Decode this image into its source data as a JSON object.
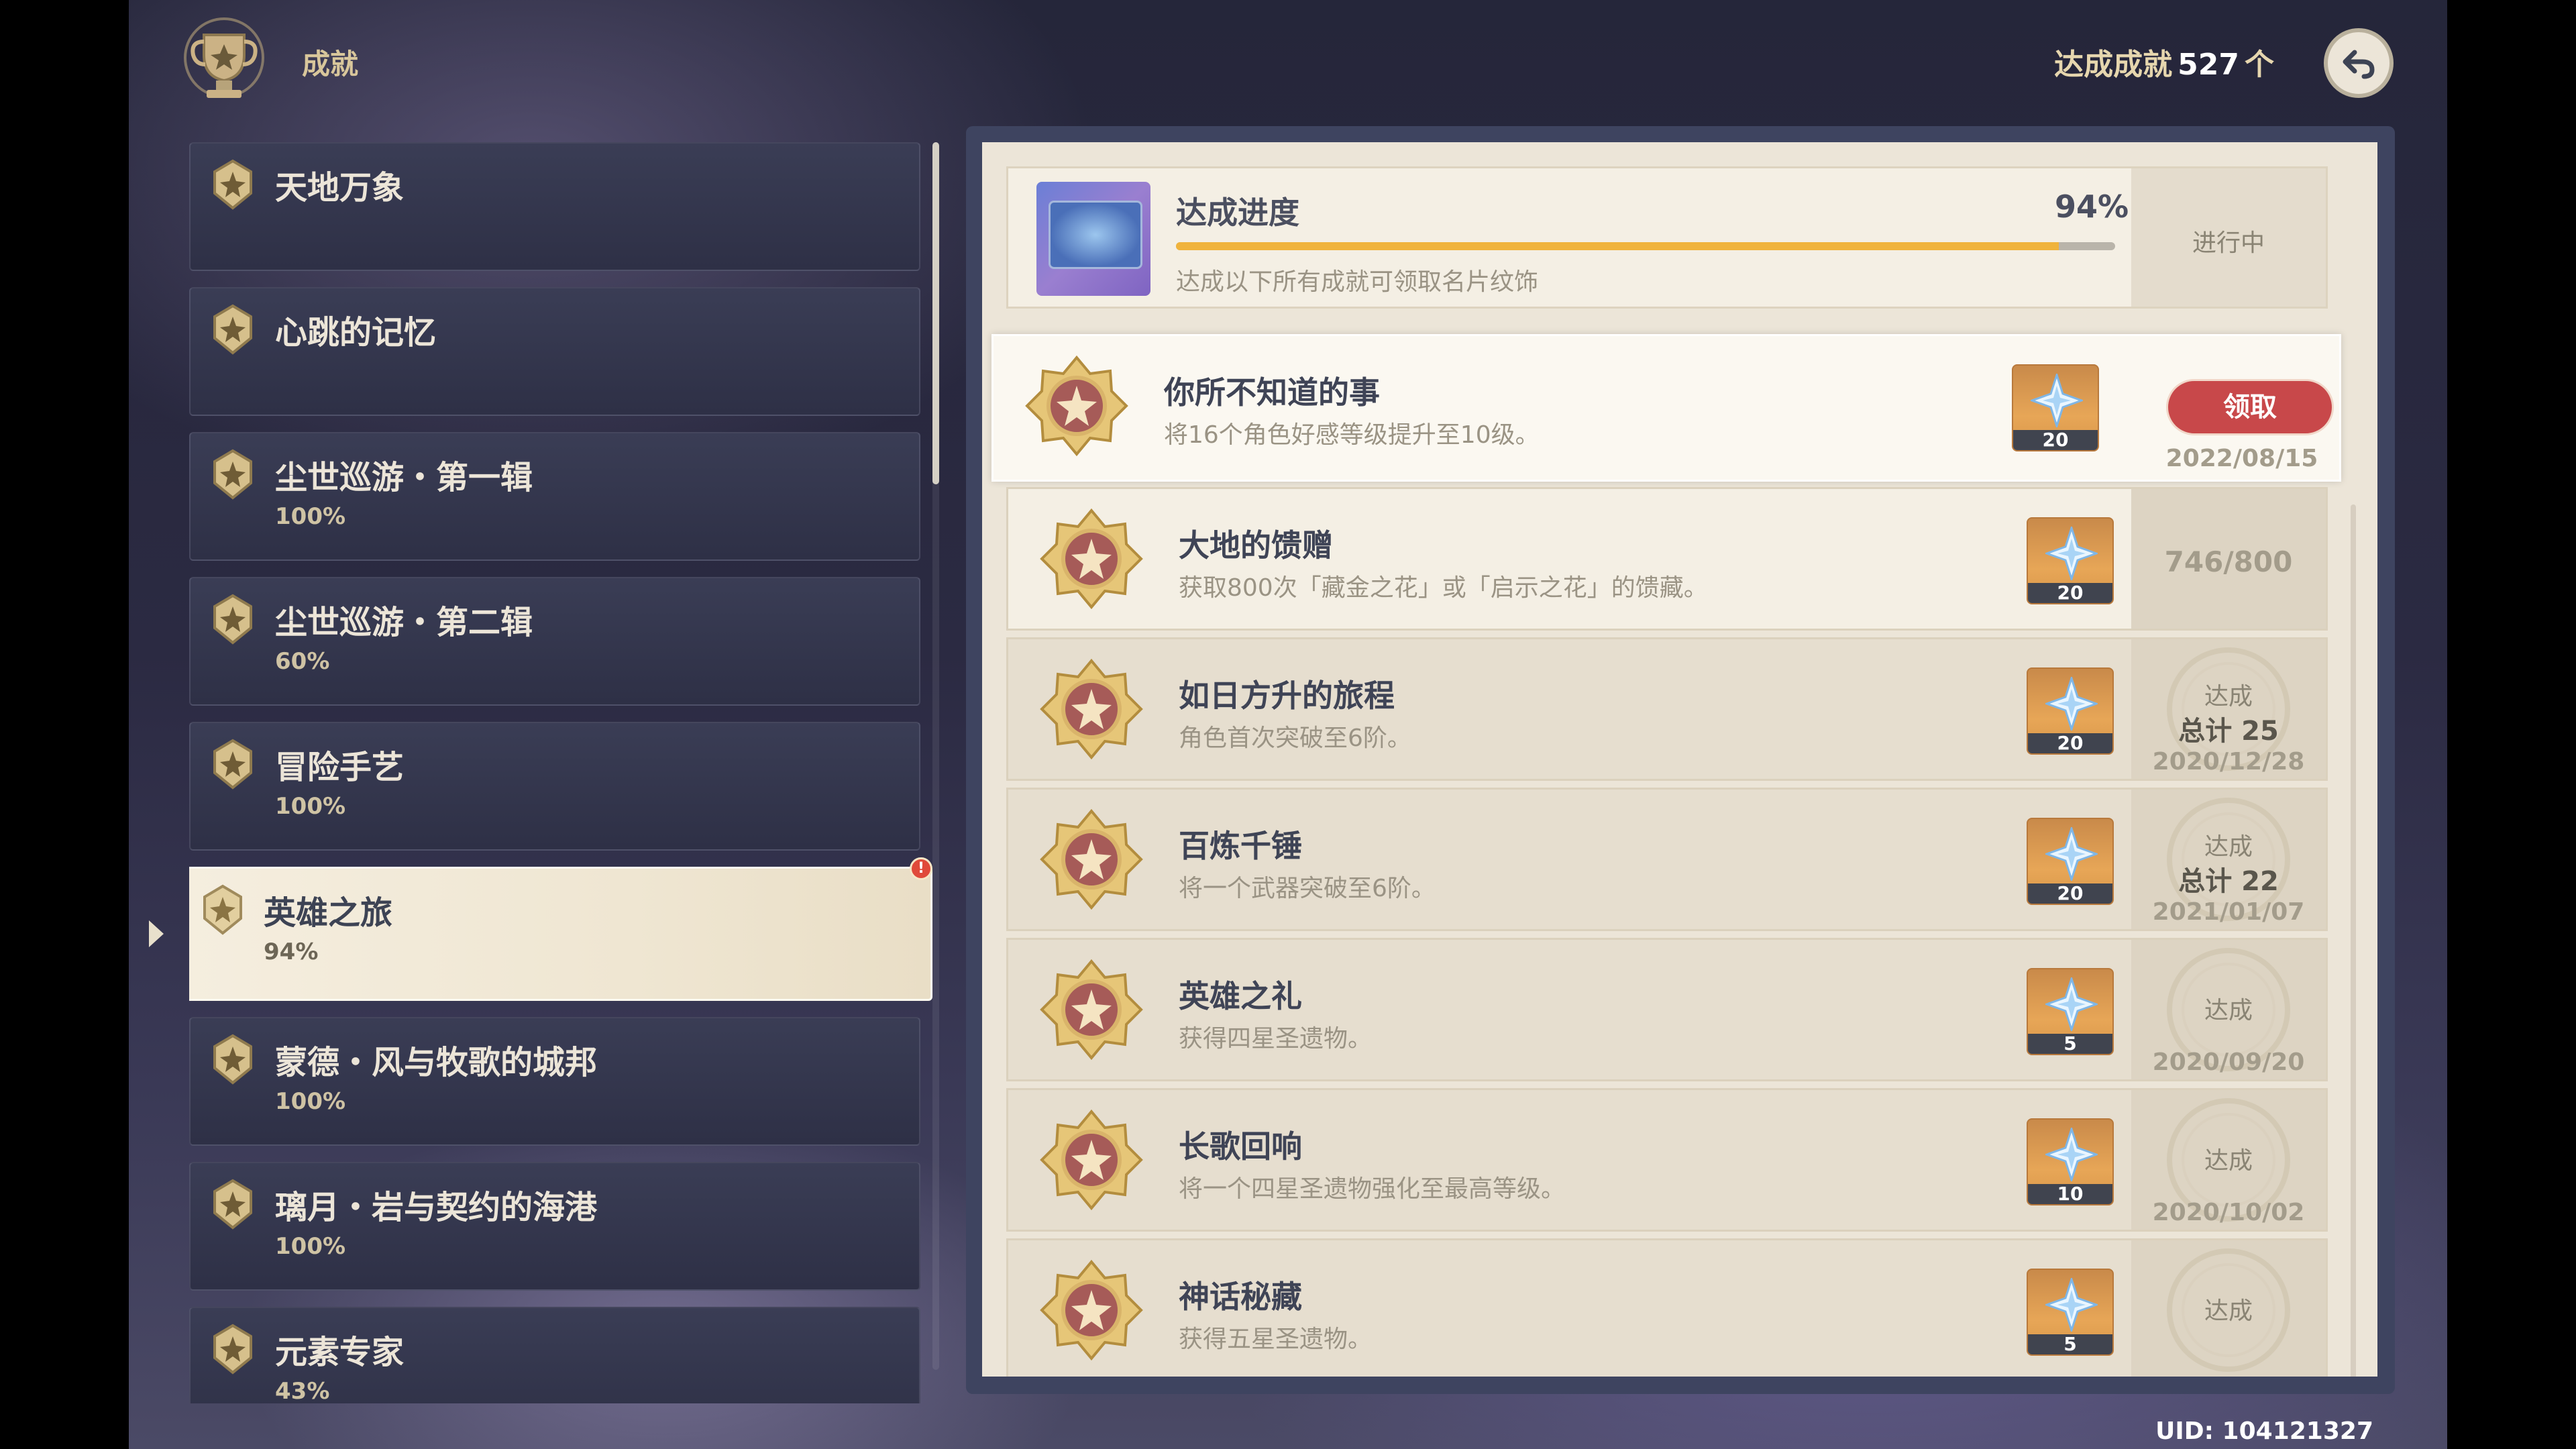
{
  "header": {
    "title": "成就",
    "total_label": "达成成就",
    "total_count": "527",
    "total_unit": "个",
    "back_icon": "back-arrow-icon"
  },
  "categories": [
    {
      "name": "天地万象",
      "percent": ""
    },
    {
      "name": "心跳的记忆",
      "percent": ""
    },
    {
      "name": "尘世巡游・第一辑",
      "percent": "100%"
    },
    {
      "name": "尘世巡游・第二辑",
      "percent": "60%"
    },
    {
      "name": "冒险手艺",
      "percent": "100%"
    },
    {
      "name": "英雄之旅",
      "percent": "94%",
      "active": true
    },
    {
      "name": "蒙德・风与牧歌的城邦",
      "percent": "100%"
    },
    {
      "name": "璃月・岩与契约的海港",
      "percent": "100%"
    },
    {
      "name": "元素专家",
      "percent": "43%"
    }
  ],
  "alert_badge": "!",
  "progress": {
    "title": "达成进度",
    "percent_label": "94%",
    "value": 0.94,
    "description": "达成以下所有成就可领取名片纹饰",
    "status": "进行中"
  },
  "achievements": [
    {
      "title": "你所不知道的事",
      "desc": "将16个角色好感等级提升至10级。",
      "reward": "20",
      "claim_label": "领取",
      "date": "2022/08/15"
    },
    {
      "title": "大地的馈赠",
      "desc": "获取800次「藏金之花」或「启示之花」的馈藏。",
      "reward": "20",
      "count": "746/800"
    },
    {
      "title": "如日方升的旅程",
      "desc": "角色首次突破至6阶。",
      "reward": "20",
      "status": "达成",
      "total": "总计 25",
      "date": "2020/12/28"
    },
    {
      "title": "百炼千锤",
      "desc": "将一个武器突破至6阶。",
      "reward": "20",
      "status": "达成",
      "total": "总计 22",
      "date": "2021/01/07"
    },
    {
      "title": "英雄之礼",
      "desc": "获得四星圣遗物。",
      "reward": "5",
      "status": "达成",
      "date": "2020/09/20"
    },
    {
      "title": "长歌回响",
      "desc": "将一个四星圣遗物强化至最高等级。",
      "reward": "10",
      "status": "达成",
      "date": "2020/10/02"
    },
    {
      "title": "神话秘藏",
      "desc": "获得五星圣遗物。",
      "reward": "5",
      "status": "达成"
    }
  ],
  "uid": "UID: 104121327",
  "colors": {
    "accent_gold": "#f0b33c",
    "claim_red": "#c8484a",
    "panel_bg": "#ece5d8"
  }
}
